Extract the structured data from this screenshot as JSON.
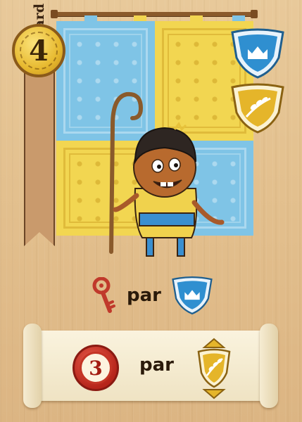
{
  "card": {
    "cost": "4",
    "character_name": "Bâtard",
    "reward_1": {
      "item_icon": "key-icon",
      "connector": "par",
      "per_icon": "crown-shield-icon"
    },
    "reward_2": {
      "token_value": "3",
      "connector": "par",
      "per_icon": "wheat-shield-up-down-icon"
    },
    "top_shields": [
      "crown-shield-icon",
      "wheat-shield-icon"
    ]
  },
  "colors": {
    "banner_blue": "#7fc4e6",
    "banner_yellow": "#f2d651",
    "coin_gold": "#e7b92f",
    "shield_blue": "#2f8fd0",
    "shield_gold": "#e5b52a",
    "token_red": "#c43526",
    "key_red": "#c0392b"
  }
}
